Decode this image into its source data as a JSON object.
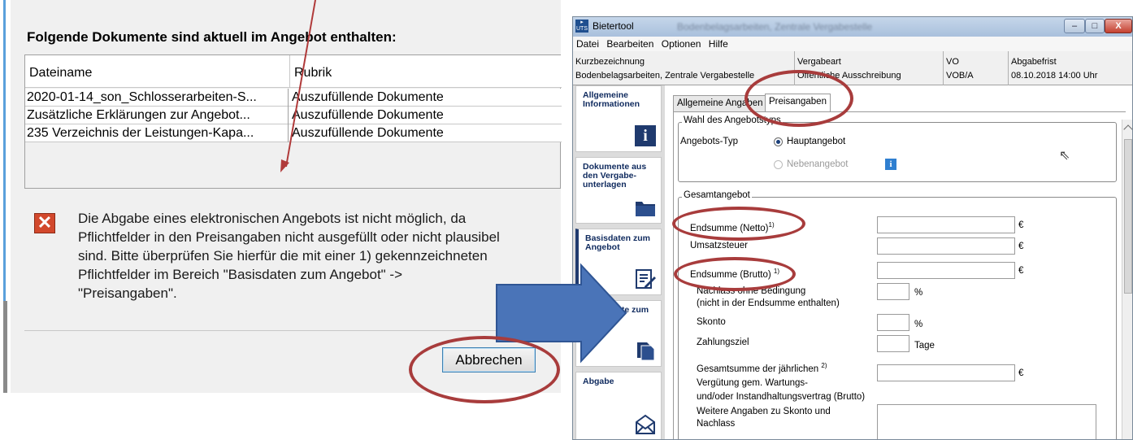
{
  "dialog": {
    "heading": "Folgende Dokumente sind aktuell im Angebot enthalten:",
    "columns": [
      "Dateiname",
      "Rubrik"
    ],
    "rows": [
      {
        "file": "2020-01-14_son_Schlosserarbeiten-S...",
        "category": "Auszufüllende Dokumente"
      },
      {
        "file": "Zusätzliche Erklärungen zur Angebot...",
        "category": "Auszufüllende Dokumente"
      },
      {
        "file": "235 Verzeichnis der Leistungen-Kapa...",
        "category": "Auszufüllende Dokumente"
      }
    ],
    "error_icon": "error-x-icon",
    "error_lines": [
      "Die Abgabe eines elektronischen Angebots ist nicht möglich, da",
      "Pflichtfelder in den Preisangaben nicht ausgefüllt oder nicht plausibel",
      "sind. Bitte überprüfen Sie hierfür die mit einer 1) gekennzeichneten",
      "Pflichtfelder im Bereich \"Basisdaten zum Angebot\" ->",
      "\"Preisangaben\"."
    ],
    "cancel_label": "Abbrechen"
  },
  "window": {
    "app_title": "Bietertool",
    "blurred_title": "Bodenbelagsarbeiten, Zentrale Vergabestelle",
    "controls": [
      "–",
      "□",
      "X"
    ],
    "menu": [
      "Datei",
      "Bearbeiten",
      "Optionen",
      "Hilfe"
    ],
    "info": {
      "kurz_label": "Kurzbezeichnung",
      "kurz_value": "Bodenbelagsarbeiten, Zentrale Vergabestelle",
      "art_label": "Vergabeart",
      "art_value": "Öffentliche Ausschreibung",
      "vo_label": "VO",
      "vo_value": "VOB/A",
      "frist_label": "Abgabefrist",
      "frist_value": "08.10.2018 14:00 Uhr"
    },
    "nav": [
      {
        "label": "Allgemeine Informationen",
        "icon": "info-icon"
      },
      {
        "label": "Dokumente aus den Vergabe-unterlagen",
        "icon": "folder-icon"
      },
      {
        "label": "Basisdaten zum Angebot",
        "icon": "edit-document-icon"
      },
      {
        "label": "Dokumente zum Angebot",
        "icon": "documents-icon"
      },
      {
        "label": "Abgabe",
        "icon": "envelope-icon"
      }
    ],
    "tabs": [
      "Allgemeine Angaben",
      "Preisangaben"
    ],
    "offer_type": {
      "legend": "Wahl des Angebotstyps",
      "label": "Angebots-Typ",
      "options": [
        "Hauptangebot",
        "Nebenangebot"
      ],
      "selected": "Hauptangebot"
    },
    "total": {
      "legend": "Gesamtangebot",
      "fields": [
        {
          "label": "Endsumme (Netto)",
          "sup": "1)",
          "unit": "€",
          "value": ""
        },
        {
          "label": "Umsatzsteuer",
          "sup": "",
          "unit": "€",
          "value": ""
        },
        {
          "label": "Endsumme (Brutto)",
          "sup": "1)",
          "unit": "€",
          "value": ""
        },
        {
          "label": "Nachlass ohne Bedingung",
          "label2": "(nicht in der Endsumme enthalten)",
          "unit": "%",
          "value": ""
        },
        {
          "label": "Skonto",
          "unit": "%",
          "value": ""
        },
        {
          "label": "Zahlungsziel",
          "unit": "Tage",
          "value": ""
        },
        {
          "label": "Gesamtsumme der jährlichen",
          "label2": "Vergütung gem. Wartungs-",
          "label3": "und/oder Instandhaltungsvertrag (Brutto)",
          "sup": "2)",
          "unit": "€",
          "value": ""
        },
        {
          "label": "Weitere Angaben zu Skonto und",
          "label2": "Nachlass",
          "value": ""
        }
      ]
    }
  },
  "colors": {
    "annotation": "#a83c3c",
    "arrow": "#4a74b8",
    "error": "#d2482c"
  }
}
